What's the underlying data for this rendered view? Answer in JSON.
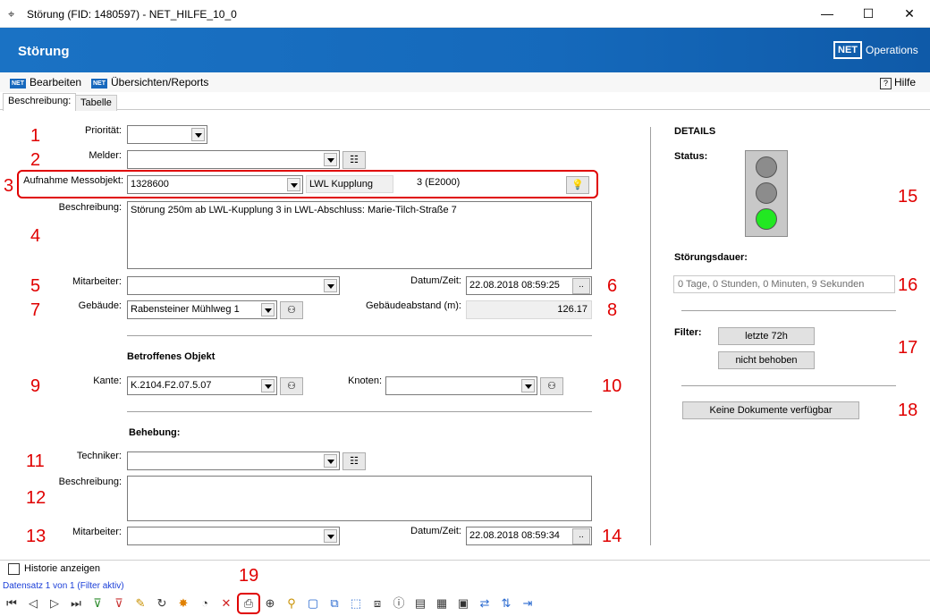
{
  "window": {
    "title": "Störung (FID: 1480597) - NET_HILFE_10_0",
    "minimize": "—",
    "maximize": "☐",
    "close": "✕"
  },
  "header": {
    "title": "Störung",
    "logo_text": "NET",
    "logo_label": "Operations"
  },
  "menu": {
    "bearbeiten": "Bearbeiten",
    "uebersichten": "Übersichten/Reports",
    "hilfe": "Hilfe",
    "net_badge": "NET",
    "help_icon": "?"
  },
  "tabs": {
    "beschreibung": "Beschreibung:",
    "tabelle": "Tabelle"
  },
  "markers": [
    "1",
    "2",
    "3",
    "4",
    "5",
    "6",
    "7",
    "8",
    "9",
    "10",
    "11",
    "12",
    "13",
    "14",
    "15",
    "16",
    "17",
    "18",
    "19"
  ],
  "form": {
    "prioritaet_label": "Priorität:",
    "melder_label": "Melder:",
    "aufnahme_label": "Aufnahme Messobjekt:",
    "aufnahme_value": "1328600",
    "messobjekt_type": "LWL Kupplung",
    "messobjekt_code": "3 (E2000)",
    "beschreibung_label": "Beschreibung:",
    "beschreibung_value": "Störung 250m ab LWL-Kupplung 3 in LWL-Abschluss: Marie-Tilch-Straße 7",
    "mitarbeiter_label": "Mitarbeiter:",
    "datum_label": "Datum/Zeit:",
    "datum_value": "22.08.2018 08:59:25",
    "gebaeude_label": "Gebäude:",
    "gebaeude_value": "Rabensteiner Mühlweg 1",
    "gebaeudeabstand_label": "Gebäudeabstand (m):",
    "gebaeudeabstand_value": "126.17",
    "betroffenes_title": "Betroffenes Objekt",
    "kante_label": "Kante:",
    "kante_value": "K.2104.F2.07.5.07",
    "knoten_label": "Knoten:",
    "behebung_title": "Behebung:",
    "techniker_label": "Techniker:",
    "beschreibung2_label": "Beschreibung:",
    "mitarbeiter2_label": "Mitarbeiter:",
    "datum2_label": "Datum/Zeit:",
    "datum2_value": "22.08.2018 08:59:34",
    "ellipsis": ".."
  },
  "details": {
    "title": "DETAILS",
    "status_label": "Status:",
    "status_active": "green",
    "dauer_label": "Störungsdauer:",
    "dauer_value": "0 Tage, 0 Stunden, 0 Minuten, 9 Sekunden",
    "filter_label": "Filter:",
    "btn_72h": "letzte 72h",
    "btn_nicht_behoben": "nicht behoben",
    "btn_dokumente": "Keine Dokumente verfügbar"
  },
  "footer": {
    "historie_label": "Historie anzeigen",
    "datensatz": "Datensatz 1 von 1 (Filter aktiv)"
  },
  "colors": {
    "marker": "#e00000",
    "header_blue": "#1769bd",
    "lamp_green": "#22e822",
    "lamp_off": "#8c8c8c"
  },
  "toolbar_icons": [
    "first-record-icon",
    "prev-record-icon",
    "next-record-icon",
    "last-record-icon",
    "filter-add-icon",
    "filter-remove-icon",
    "edit-pencil-icon",
    "refresh-icon",
    "new-star-icon",
    "gauge-icon",
    "delete-icon",
    "print-icon",
    "zoom-in-icon",
    "zoom-map-icon",
    "box-icon",
    "copy-box-icon",
    "select-box-icon",
    "layers-icon",
    "info-icon",
    "document-icon",
    "report-icon",
    "export-icon",
    "connect-icon",
    "sort-icon",
    "exit-icon"
  ]
}
